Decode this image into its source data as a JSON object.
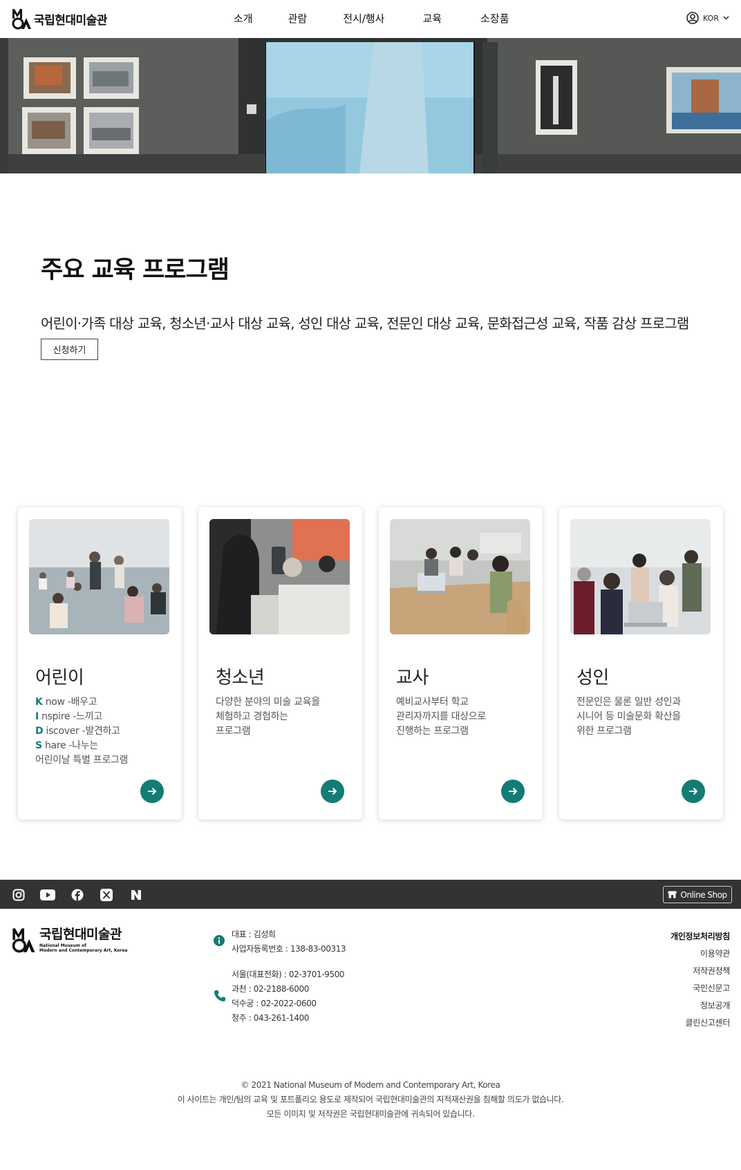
{
  "header": {
    "logo_text": "국립현대미술관",
    "nav": [
      "소개",
      "관람",
      "전시/행사",
      "교육",
      "소장품"
    ],
    "language": "KOR"
  },
  "main": {
    "title": "주요 교육 프로그램",
    "description": "어린이·가족 대상 교육, 청소년·교사 대상 교육, 성인 대상 교육, 전문인 대상 교육, 문화접근성 교육, 작품 감상 프로그램",
    "apply_button": "신청하기"
  },
  "cards": [
    {
      "title": "어린이",
      "know": {
        "letter": "K",
        "rest": " now -배우고"
      },
      "inspire": {
        "letter": "I",
        "rest": " nspire -느끼고"
      },
      "discover": {
        "letter": "D",
        "rest": " iscover -발견하고"
      },
      "share": {
        "letter": "S",
        "rest": " hare -나누는"
      },
      "last": "어린이날 특별 프로그램"
    },
    {
      "title": "청소년",
      "lines": [
        "다양한 분야의 미술 교육을",
        "체험하고 경험하는",
        "프로그램"
      ]
    },
    {
      "title": "교사",
      "lines": [
        "예비교사부터 학교",
        "관리자까지를 대상으로",
        "진행하는 프로그램"
      ]
    },
    {
      "title": "성인",
      "lines": [
        "전문인은 물론 일반 성인과",
        "시니어 등 미술문화 확산을",
        "위한 프로그램"
      ]
    }
  ],
  "footer": {
    "shop_label": "Online Shop",
    "logo_name": "국립현대미술관",
    "logo_sub_1": "National Museum of",
    "logo_sub_2": "Modern and Contemporary Art, Korea",
    "ceo": "대표 : 김성희",
    "biz_no": "사업자등록번호 : 138-83-00313",
    "phones": [
      "서울(대표전화) : 02-3701-9500",
      "과천 : 02-2188-6000",
      "덕수궁 : 02-2022-0600",
      "청주 : 043-261-1400"
    ],
    "links": [
      "개인정보처리방침",
      "이용약관",
      "저작권정책",
      "국민신문고",
      "정보공개",
      "클린신고센터"
    ],
    "copyright": "© 2021 National Museum of Modern and Contemporary Art, Korea",
    "notice_1": "이 사이트는 개인/팀의 교육 및 포트폴리오 용도로 제작되어 국립현대미술관의 지적재산권을 침해할 의도가 없습니다.",
    "notice_2": "모든 이미지 및 저작권은 국립현대미술관에 귀속되어 있습니다."
  }
}
